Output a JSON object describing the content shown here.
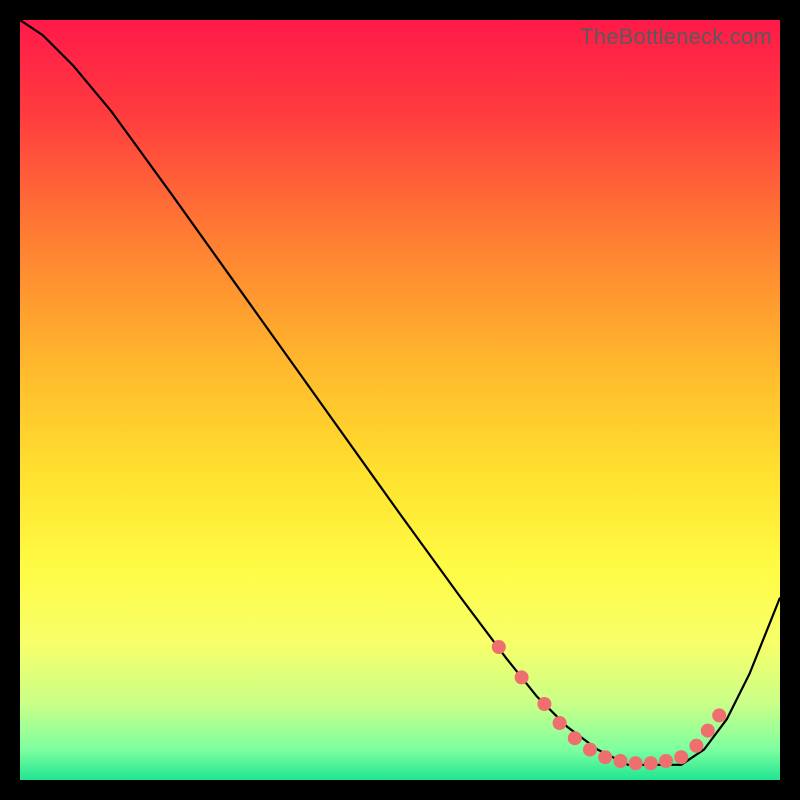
{
  "watermark": "TheBottleneck.com",
  "gradient": {
    "stops": [
      {
        "offset": "0%",
        "color": "#ff1a49"
      },
      {
        "offset": "12%",
        "color": "#ff3a3f"
      },
      {
        "offset": "28%",
        "color": "#ff7b33"
      },
      {
        "offset": "45%",
        "color": "#ffb72d"
      },
      {
        "offset": "60%",
        "color": "#ffe22f"
      },
      {
        "offset": "72%",
        "color": "#fffb44"
      },
      {
        "offset": "82%",
        "color": "#f7ff6a"
      },
      {
        "offset": "90%",
        "color": "#c9ff88"
      },
      {
        "offset": "96%",
        "color": "#7dffa0"
      },
      {
        "offset": "100%",
        "color": "#20e592"
      }
    ]
  },
  "chart_data": {
    "type": "line",
    "title": "",
    "xlabel": "",
    "ylabel": "",
    "xlim": [
      0,
      1
    ],
    "ylim": [
      0,
      1
    ],
    "series": [
      {
        "name": "curve",
        "x": [
          0.0,
          0.03,
          0.07,
          0.12,
          0.2,
          0.3,
          0.4,
          0.5,
          0.58,
          0.64,
          0.68,
          0.72,
          0.76,
          0.8,
          0.84,
          0.87,
          0.9,
          0.93,
          0.96,
          1.0
        ],
        "y": [
          1.0,
          0.98,
          0.94,
          0.88,
          0.77,
          0.63,
          0.49,
          0.35,
          0.24,
          0.16,
          0.11,
          0.07,
          0.04,
          0.02,
          0.02,
          0.02,
          0.04,
          0.08,
          0.14,
          0.24
        ]
      }
    ],
    "markers": {
      "name": "dots",
      "x": [
        0.63,
        0.66,
        0.69,
        0.71,
        0.73,
        0.75,
        0.77,
        0.79,
        0.81,
        0.83,
        0.85,
        0.87,
        0.89,
        0.905,
        0.92
      ],
      "y": [
        0.175,
        0.135,
        0.1,
        0.075,
        0.055,
        0.04,
        0.03,
        0.025,
        0.022,
        0.022,
        0.025,
        0.03,
        0.045,
        0.065,
        0.085
      ]
    },
    "marker_color": "#ef6e6e",
    "line_color": "#000000"
  }
}
